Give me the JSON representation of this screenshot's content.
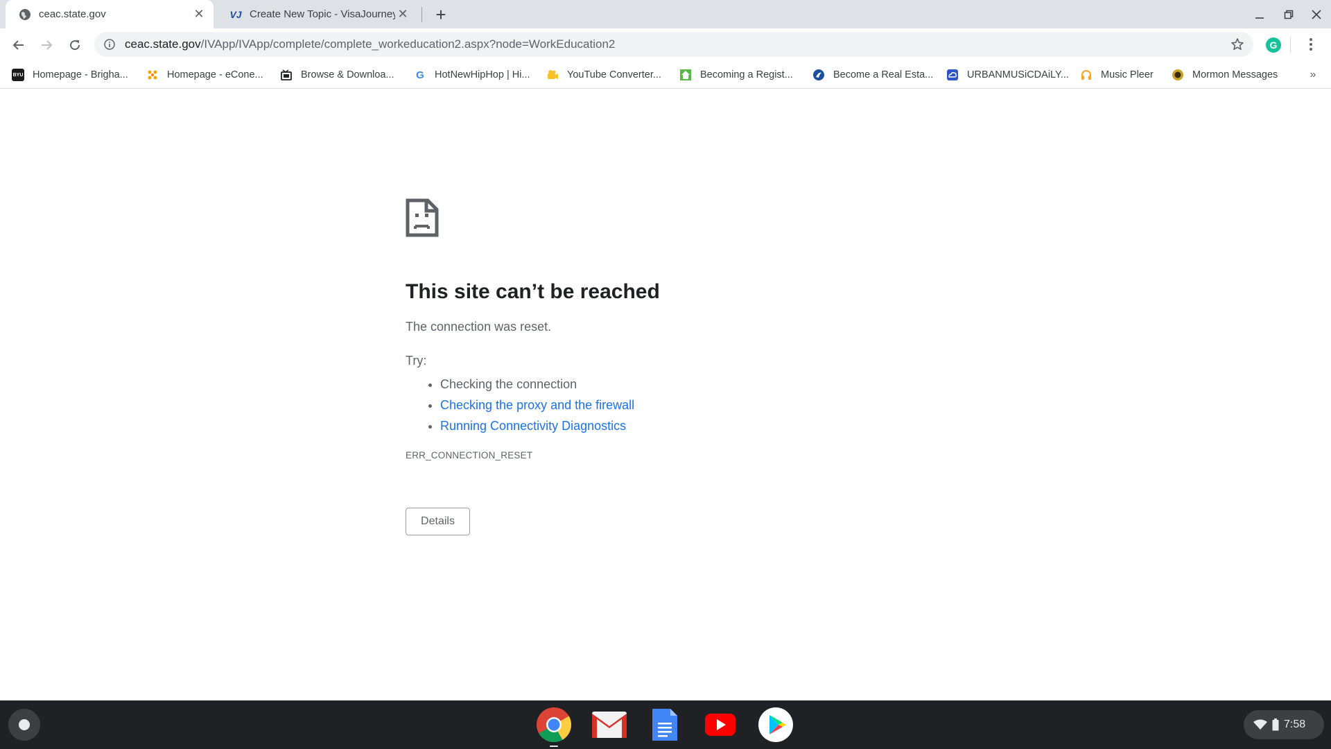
{
  "tabs": [
    {
      "title": "ceac.state.gov",
      "favicon": "globe-icon",
      "active": true
    },
    {
      "title": "Create New Topic - VisaJourney",
      "favicon": "visajourney-icon",
      "favicon_text": "VJ",
      "active": false
    }
  ],
  "toolbar": {
    "url_host": "ceac.state.gov",
    "url_path": "/IVApp/IVApp/complete/complete_workeducation2.aspx?node=WorkEducation2",
    "extension_label": "G"
  },
  "bookmarks": [
    {
      "label": "Homepage - Brigha...",
      "icon": "byu-icon",
      "icon_text": "BYU"
    },
    {
      "label": "Homepage - eCone...",
      "icon": "econe-icon"
    },
    {
      "label": "Browse & Downloa...",
      "icon": "film-icon"
    },
    {
      "label": "HotNewHipHop | Hi...",
      "icon": "google-icon",
      "icon_text": "G"
    },
    {
      "label": "YouTube Converter...",
      "icon": "converter-icon"
    },
    {
      "label": "Becoming a Regist...",
      "icon": "house-icon"
    },
    {
      "label": "Become a Real Esta...",
      "icon": "realestate-icon"
    },
    {
      "label": "URBANMUSiCDAiLY...",
      "icon": "cloud-icon"
    },
    {
      "label": "Music Pleer",
      "icon": "headphones-icon"
    },
    {
      "label": "Mormon Messages",
      "icon": "mormon-icon"
    }
  ],
  "bookmarks_more": "»",
  "error": {
    "heading": "This site can’t be reached",
    "message": "The connection was reset.",
    "try_label": "Try:",
    "suggestions": [
      {
        "text": "Checking the connection",
        "link": false
      },
      {
        "text": "Checking the proxy and the firewall",
        "link": true
      },
      {
        "text": "Running Connectivity Diagnostics",
        "link": true
      }
    ],
    "code": "ERR_CONNECTION_RESET",
    "details_button": "Details"
  },
  "shelf": {
    "apps": [
      "chrome-icon",
      "gmail-icon",
      "docs-icon",
      "youtube-icon",
      "play-store-icon"
    ],
    "time": "7:58"
  },
  "colors": {
    "link": "#1a73e8",
    "text": "#202124",
    "secondary": "#5f6368",
    "shelf": "#202124"
  }
}
